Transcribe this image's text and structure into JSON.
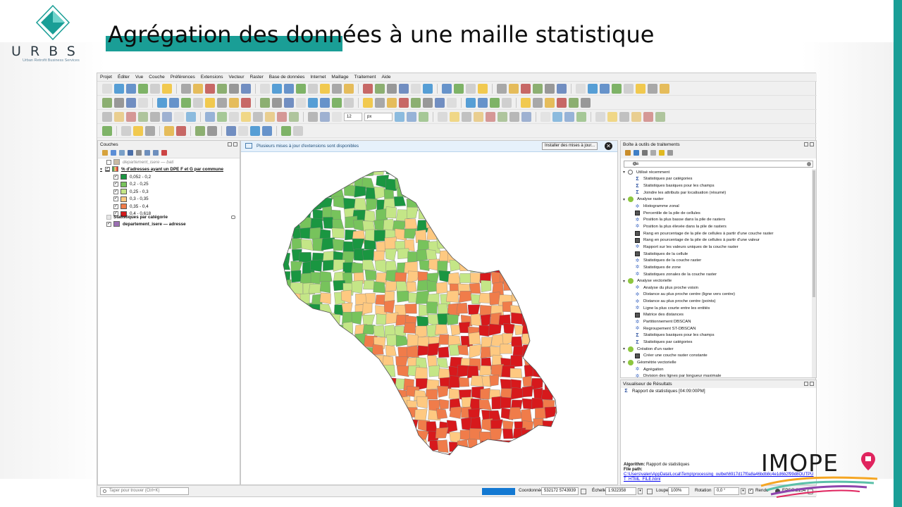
{
  "slide": {
    "title": "Agrégation des données à une maille statistique",
    "logo": {
      "letters": "URBS",
      "tagline": "Urban Retrofit Business Services"
    },
    "partner_logo": "IMOPE",
    "accent_color": "#1a9e96"
  },
  "qgis": {
    "menu": [
      "Projet",
      "Éditer",
      "Vue",
      "Couche",
      "Préférences",
      "Extensions",
      "Vecteur",
      "Raster",
      "Base de données",
      "Internet",
      "Maillage",
      "Traitement",
      "Aide"
    ],
    "toolbar": {
      "font_size": "12",
      "font_unit": "px"
    },
    "layers_panel": {
      "title": "Couches",
      "layers": [
        {
          "name": "departement_isere — bati",
          "checked": false
        },
        {
          "name": "% d'adresses ayant un DPE F et G par commune",
          "checked": true
        },
        {
          "name": "Statistiques par catégorie",
          "checked": false
        },
        {
          "name": "departement_isere — adresse",
          "checked": true
        }
      ],
      "legend": [
        {
          "label": "0,052 - 0,2",
          "color": "#1a9641"
        },
        {
          "label": "0,2 - 0,25",
          "color": "#77c35c"
        },
        {
          "label": "0,25 - 0,3",
          "color": "#c4e687"
        },
        {
          "label": "0,3 - 0,35",
          "color": "#fec981"
        },
        {
          "label": "0,35 - 0,4",
          "color": "#f07c4a"
        },
        {
          "label": "0,4 - 0,618",
          "color": "#d7191c"
        }
      ]
    },
    "message_bar": {
      "message": "Plusieurs mises à jour d'extensions sont disponibles",
      "button": "Installer des mises à jour..."
    },
    "processing_toolbox": {
      "title": "Boîte à outils de traitements",
      "search": "sta",
      "groups": [
        {
          "name": "Utilisé récemment",
          "icon": "clock-icon",
          "items": [
            {
              "label": "Statistiques par catégories",
              "icon": "sigma"
            },
            {
              "label": "Statistiques basiques pour les champs",
              "icon": "sigma"
            },
            {
              "label": "Joindre les attributs par localisation (résumé)",
              "icon": "sigma"
            }
          ]
        },
        {
          "name": "Analyse raster",
          "icon": "qgis-icon",
          "items": [
            {
              "label": "Histogramme zonal",
              "icon": "gear"
            },
            {
              "label": "Percentile de la pile de cellules",
              "icon": "grid"
            },
            {
              "label": "Position la plus basse dans la pile de rasters",
              "icon": "gear"
            },
            {
              "label": "Position la plus élevée dans la pile de rasters",
              "icon": "gear"
            },
            {
              "label": "Rang en pourcentage de la pile de cellules à partir d'une couche raster",
              "icon": "grid"
            },
            {
              "label": "Rang en pourcentage de la pile de cellules à partir d'une valeur",
              "icon": "grid"
            },
            {
              "label": "Rapport sur les valeurs uniques de la couche raster",
              "icon": "gear"
            },
            {
              "label": "Statistiques de la cellule",
              "icon": "grid"
            },
            {
              "label": "Statistiques de la couche raster",
              "icon": "gear"
            },
            {
              "label": "Statistiques de zone",
              "icon": "gear"
            },
            {
              "label": "Statistiques zonales de la couche raster",
              "icon": "gear"
            }
          ]
        },
        {
          "name": "Analyse vectorielle",
          "icon": "qgis-icon",
          "items": [
            {
              "label": "Analyse du plus proche voisin",
              "icon": "gear"
            },
            {
              "label": "Distance au plus proche centre (ligne vers centre)",
              "icon": "gear"
            },
            {
              "label": "Distance au plus proche centre (points)",
              "icon": "gear"
            },
            {
              "label": "Ligne la plus courte entre les entités",
              "icon": "gear"
            },
            {
              "label": "Matrice des distances",
              "icon": "grid"
            },
            {
              "label": "Partitionnement DBSCAN",
              "icon": "gear"
            },
            {
              "label": "Regroupement ST-DBSCAN",
              "icon": "gear"
            },
            {
              "label": "Statistiques basiques pour les champs",
              "icon": "sigma"
            },
            {
              "label": "Statistiques par catégories",
              "icon": "sigma"
            }
          ]
        },
        {
          "name": "Création d'un raster",
          "icon": "qgis-icon",
          "items": [
            {
              "label": "Créer une couche raster constante",
              "icon": "grid"
            }
          ]
        },
        {
          "name": "Géométrie vectorielle",
          "icon": "qgis-icon",
          "items": [
            {
              "label": "Agrégation",
              "icon": "gear"
            },
            {
              "label": "Division des lignes par longueur maximale",
              "icon": "gear"
            }
          ]
        }
      ]
    },
    "results_viewer": {
      "title": "Visualiseur de Résultats",
      "item": "Rapport de statistiques [04:09:00PM]",
      "info": {
        "algorithm_label": "Algorithm:",
        "algorithm": "Rapport de statistiques",
        "file_label": "File path:",
        "file_path": "C:\\Users\\valen\\AppData\\Local\\Temp\\processing_oulbet\\6917d17f0a8a46bdb8c4e1d6b2f99d8OUTPUT_HTML_FILE.html"
      }
    },
    "status_bar": {
      "locator_placeholder": "Taper pour trouver (Ctrl+K)",
      "coord_label": "Coordonnée",
      "coord_value": "532172  5743939",
      "scale_label": "Échelle",
      "scale_value": "1:922358",
      "magnifier_label": "Loupe",
      "magnifier_value": "100%",
      "rotation_label": "Rotation",
      "rotation_value": "0,0 °",
      "render_label": "Rendu",
      "crs": "EPSG:2154"
    }
  }
}
